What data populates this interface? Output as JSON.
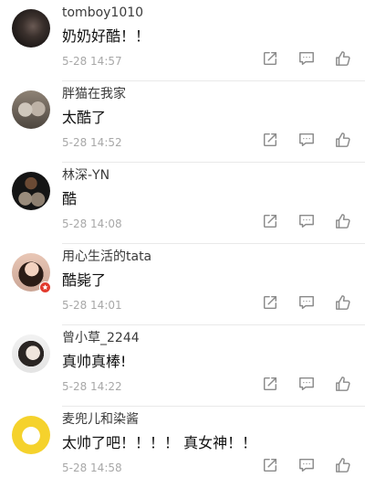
{
  "comments": [
    {
      "username": "tomboy1010",
      "text": "奶奶好酷！！",
      "time": "5-28 14:57",
      "avatar": "dark-portrait"
    },
    {
      "username": "胖猫在我家",
      "text": "太酷了",
      "time": "5-28 14:52",
      "avatar": "cats"
    },
    {
      "username": "林深-YN",
      "text": "酷",
      "time": "5-28 14:08",
      "avatar": "drum-kit"
    },
    {
      "username": "用心生活的tata",
      "text": "酷毙了",
      "time": "5-28 14:01",
      "avatar": "girl-portrait",
      "badge": "verified-badge"
    },
    {
      "username": "曾小草_2244",
      "text": "真帅真棒!",
      "time": "5-28 14:22",
      "avatar": "man-portrait"
    },
    {
      "username": "麦兜儿和染酱",
      "text": "太帅了吧！！！！ 真女神！！",
      "time": "5-28 14:58",
      "avatar": "yellow-cartoon"
    }
  ],
  "icons": {
    "share": "share-icon",
    "reply": "comment-icon",
    "like": "thumbs-up-icon"
  },
  "colors": {
    "icon": "#8a8a8a",
    "timestamp": "#a8a8a8",
    "badge": "#e23b2e"
  }
}
